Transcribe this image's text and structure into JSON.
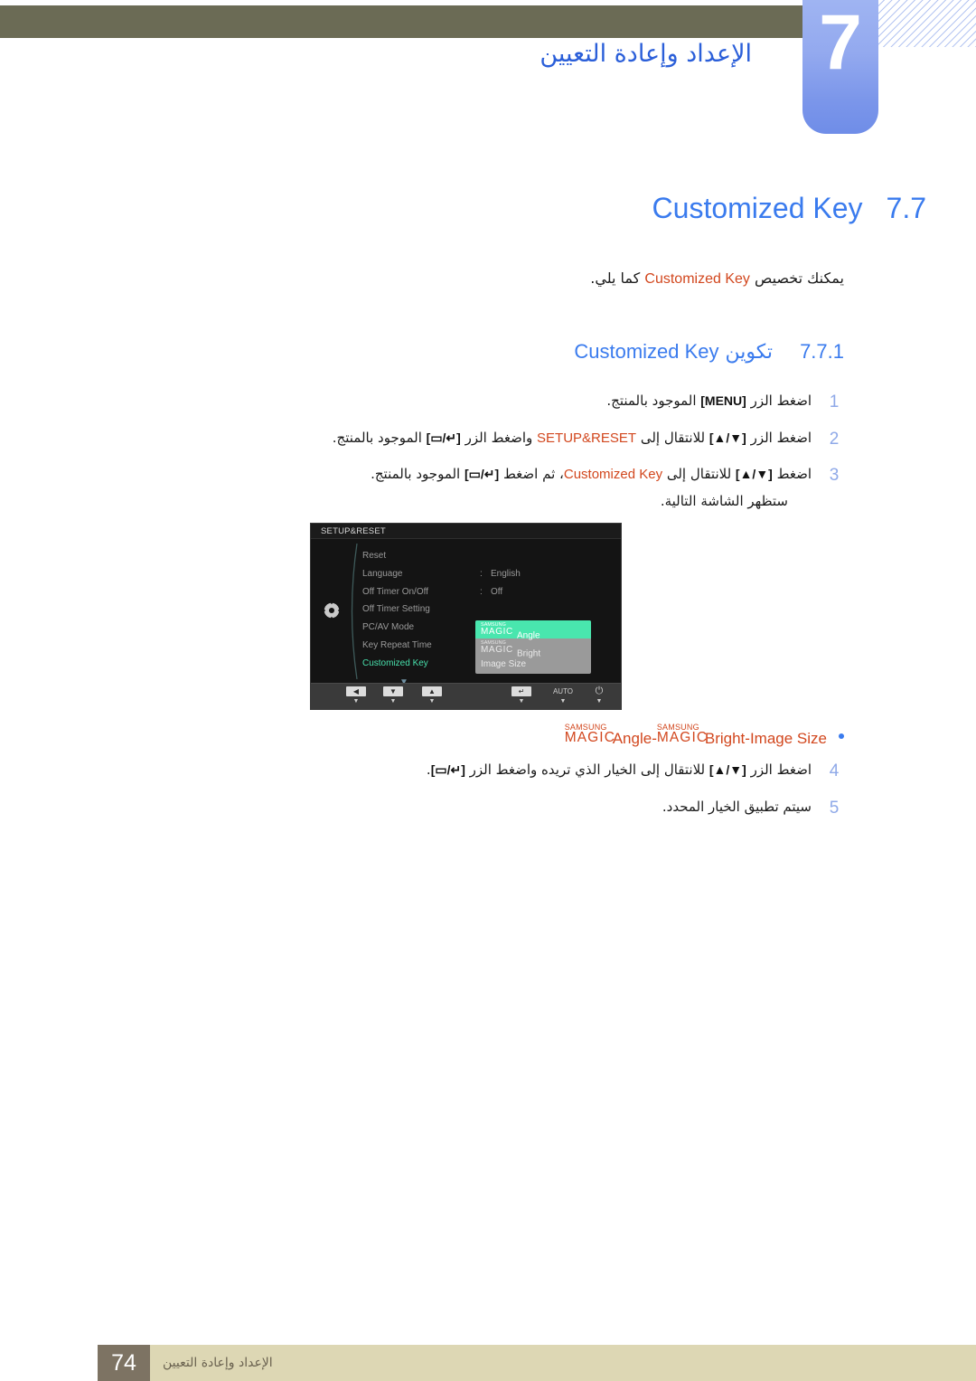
{
  "header": {
    "chapter_number": "7",
    "chapter_title": "الإعداد وإعادة التعيين"
  },
  "section": {
    "number": "7.7",
    "title": "Customized Key",
    "intro_prefix": "يمكنك تخصيص ",
    "intro_highlight": "Customized Key",
    "intro_suffix": " كما يلي."
  },
  "subsection": {
    "number": "7.7.1",
    "title_ar": "تكوين ",
    "title_en": "Customized Key"
  },
  "steps": [
    {
      "num": "1",
      "pre": "اضغط الزر ",
      "key": "[MENU]",
      "post": " الموجود بالمنتج.",
      "sub": ""
    },
    {
      "num": "2",
      "pre": "اضغط الزر ",
      "key": "[▲/▼]",
      "mid1": " للانتقال إلى ",
      "highlight": "SETUP&RESET",
      "mid2": " واضغط الزر ",
      "key2": "[▭/↵]",
      "post": " الموجود بالمنتج.",
      "sub": ""
    },
    {
      "num": "3",
      "pre": "اضغط ",
      "key": "[▲/▼]",
      "mid1": " للانتقال إلى ",
      "highlight": "Customized Key",
      "mid2": "، ثم اضغط ",
      "key2": "[▭/↵]",
      "post": " الموجود بالمنتج.",
      "sub": "ستظهر الشاشة التالية."
    }
  ],
  "steps2": [
    {
      "num": "4",
      "pre": "اضغط الزر ",
      "key": "[▲/▼]",
      "mid1": " للانتقال إلى الخيار الذي تريده واضغط الزر ",
      "key2": "[▭/↵]",
      "post": ".",
      "sub": ""
    },
    {
      "num": "5",
      "pre": "سيتم تطبيق الخيار المحدد.",
      "key": "",
      "post": "",
      "sub": ""
    }
  ],
  "bullet": {
    "magic_top": "SAMSUNG",
    "magic_bottom": "MAGIC",
    "angle": "Angle",
    "sep1": " - ",
    "bright": "Bright",
    "sep2": " - ",
    "image_size": "Image Size"
  },
  "osd": {
    "title": "SETUP&RESET",
    "menu": [
      {
        "label": "Reset",
        "colon": "",
        "value": ""
      },
      {
        "label": "Language",
        "colon": ":",
        "value": "English"
      },
      {
        "label": "Off Timer On/Off",
        "colon": ":",
        "value": "Off"
      },
      {
        "label": "Off Timer Setting",
        "colon": "",
        "value": ""
      },
      {
        "label": "PC/AV Mode",
        "colon": "",
        "value": ""
      },
      {
        "label": "Key Repeat Time",
        "colon": ":",
        "value": ""
      },
      {
        "label": "Customized Key",
        "colon": ":",
        "value": ""
      }
    ],
    "scroll_glyph": "▼",
    "dropdown": [
      {
        "magic_top": "SAMSUNG",
        "magic_bottom": "MAGIC",
        "label": "Angle",
        "selected": true
      },
      {
        "magic_top": "SAMSUNG",
        "magic_bottom": "MAGIC",
        "label": "Bright",
        "selected": false
      },
      {
        "magic_top": "",
        "magic_bottom": "",
        "label": "Image Size",
        "selected": false
      }
    ],
    "buttons": [
      {
        "glyph": "◀",
        "type": "glyph",
        "tick": "▼"
      },
      {
        "glyph": "▼",
        "type": "glyph",
        "tick": "▼"
      },
      {
        "glyph": "▲",
        "type": "glyph",
        "tick": "▼"
      },
      {
        "glyph": "↵",
        "type": "glyph",
        "tick": "▼"
      },
      {
        "glyph": "AUTO",
        "type": "text",
        "tick": "▼"
      },
      {
        "glyph": "⏻",
        "type": "text",
        "tick": "▼"
      }
    ]
  },
  "footer": {
    "page_number": "74",
    "text": "الإعداد وإعادة التعيين"
  },
  "colors": {
    "olive_bar": "#6b6b55",
    "chapter_blue": "#7b96ea",
    "heading_blue": "#3a7bee",
    "highlight_orange": "#d2471e",
    "osd_accent": "#48e0ac",
    "footer_tan": "#ddd7b4",
    "footer_box": "#7d7363"
  }
}
